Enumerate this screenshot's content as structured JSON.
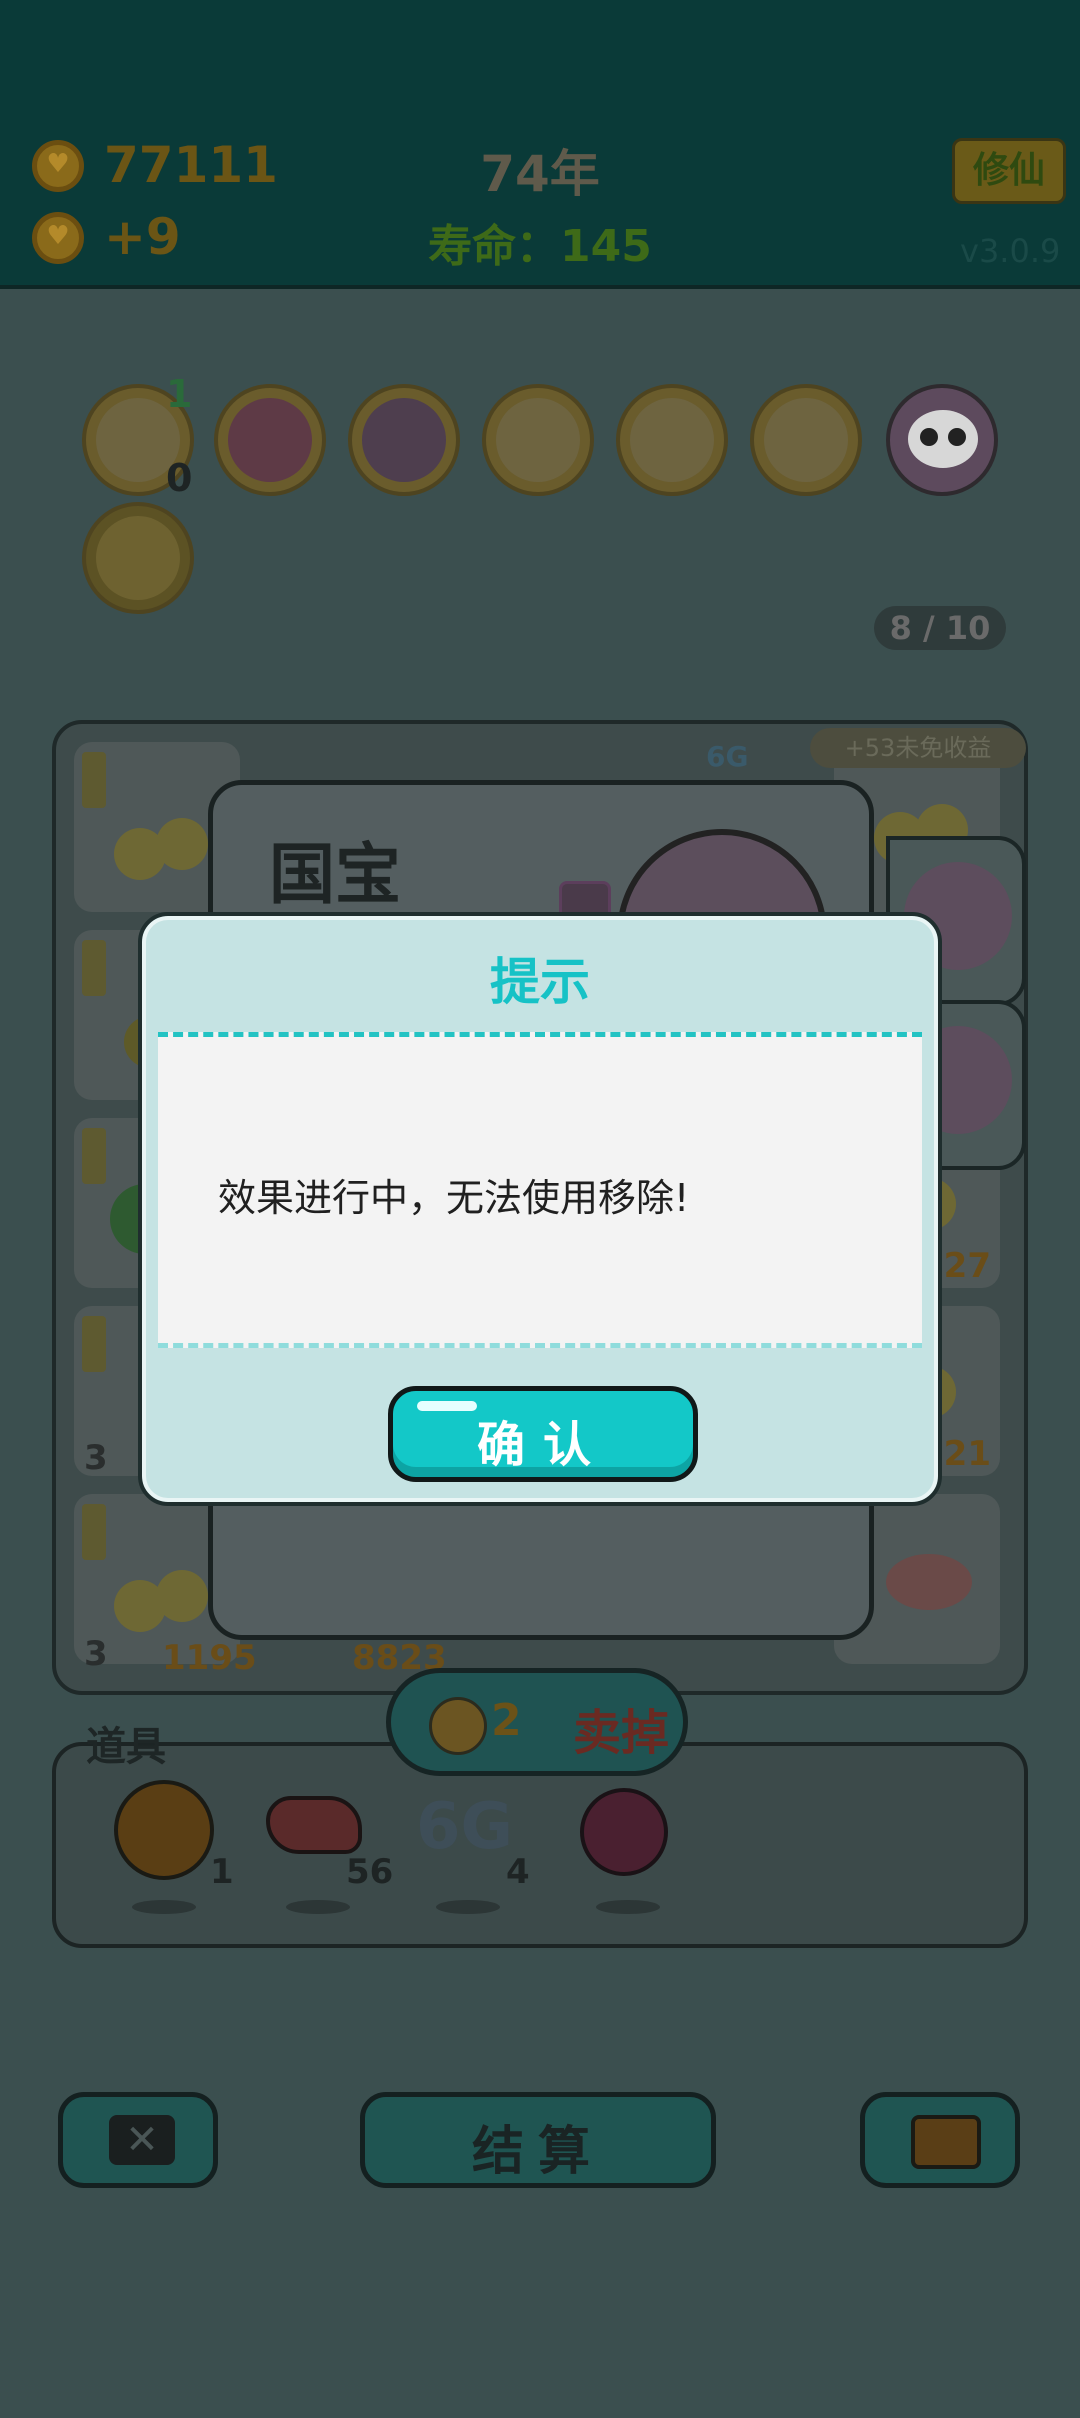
{
  "hud": {
    "coins": "77111",
    "income": "+9",
    "year": "74年",
    "lifespan": "寿命：145",
    "xiuxian_label": "修仙",
    "version": "v3.0.9"
  },
  "relics": {
    "badges": [
      "1",
      "0"
    ],
    "icons": [
      "shell-icon",
      "time-magazine-icon",
      "rock-hand-icon",
      "fruit-plate-icon",
      "fruit-plate-icon",
      "fruit-plate-icon",
      "panda-icon",
      "lightning-icon"
    ],
    "count": "8 / 10"
  },
  "board": {
    "income_hint": "+53未免收益",
    "tag_6g": "6G",
    "cell_numbers": [
      "227",
      "121",
      "3",
      "3",
      "1195",
      "8823"
    ]
  },
  "card": {
    "title": "国宝"
  },
  "sell": {
    "price": "2",
    "label": "卖掉"
  },
  "tools": {
    "label": "道具",
    "items": [
      {
        "icon": "coin-icon",
        "count": "1"
      },
      {
        "icon": "liver-icon",
        "count": "56"
      },
      {
        "icon": "6g-icon",
        "count": "4"
      },
      {
        "icon": "bayberry-icon",
        "count": ""
      }
    ],
    "g6_text": "6G"
  },
  "bottom": {
    "settle": "结算"
  },
  "dialog": {
    "title": "提示",
    "message": "效果进行中，无法使用移除!",
    "confirm": "确认"
  },
  "colors": {
    "dialog_bg": "#c5e3e3",
    "accent": "#16c2c6",
    "confirm_bg": "#13c8c8"
  }
}
